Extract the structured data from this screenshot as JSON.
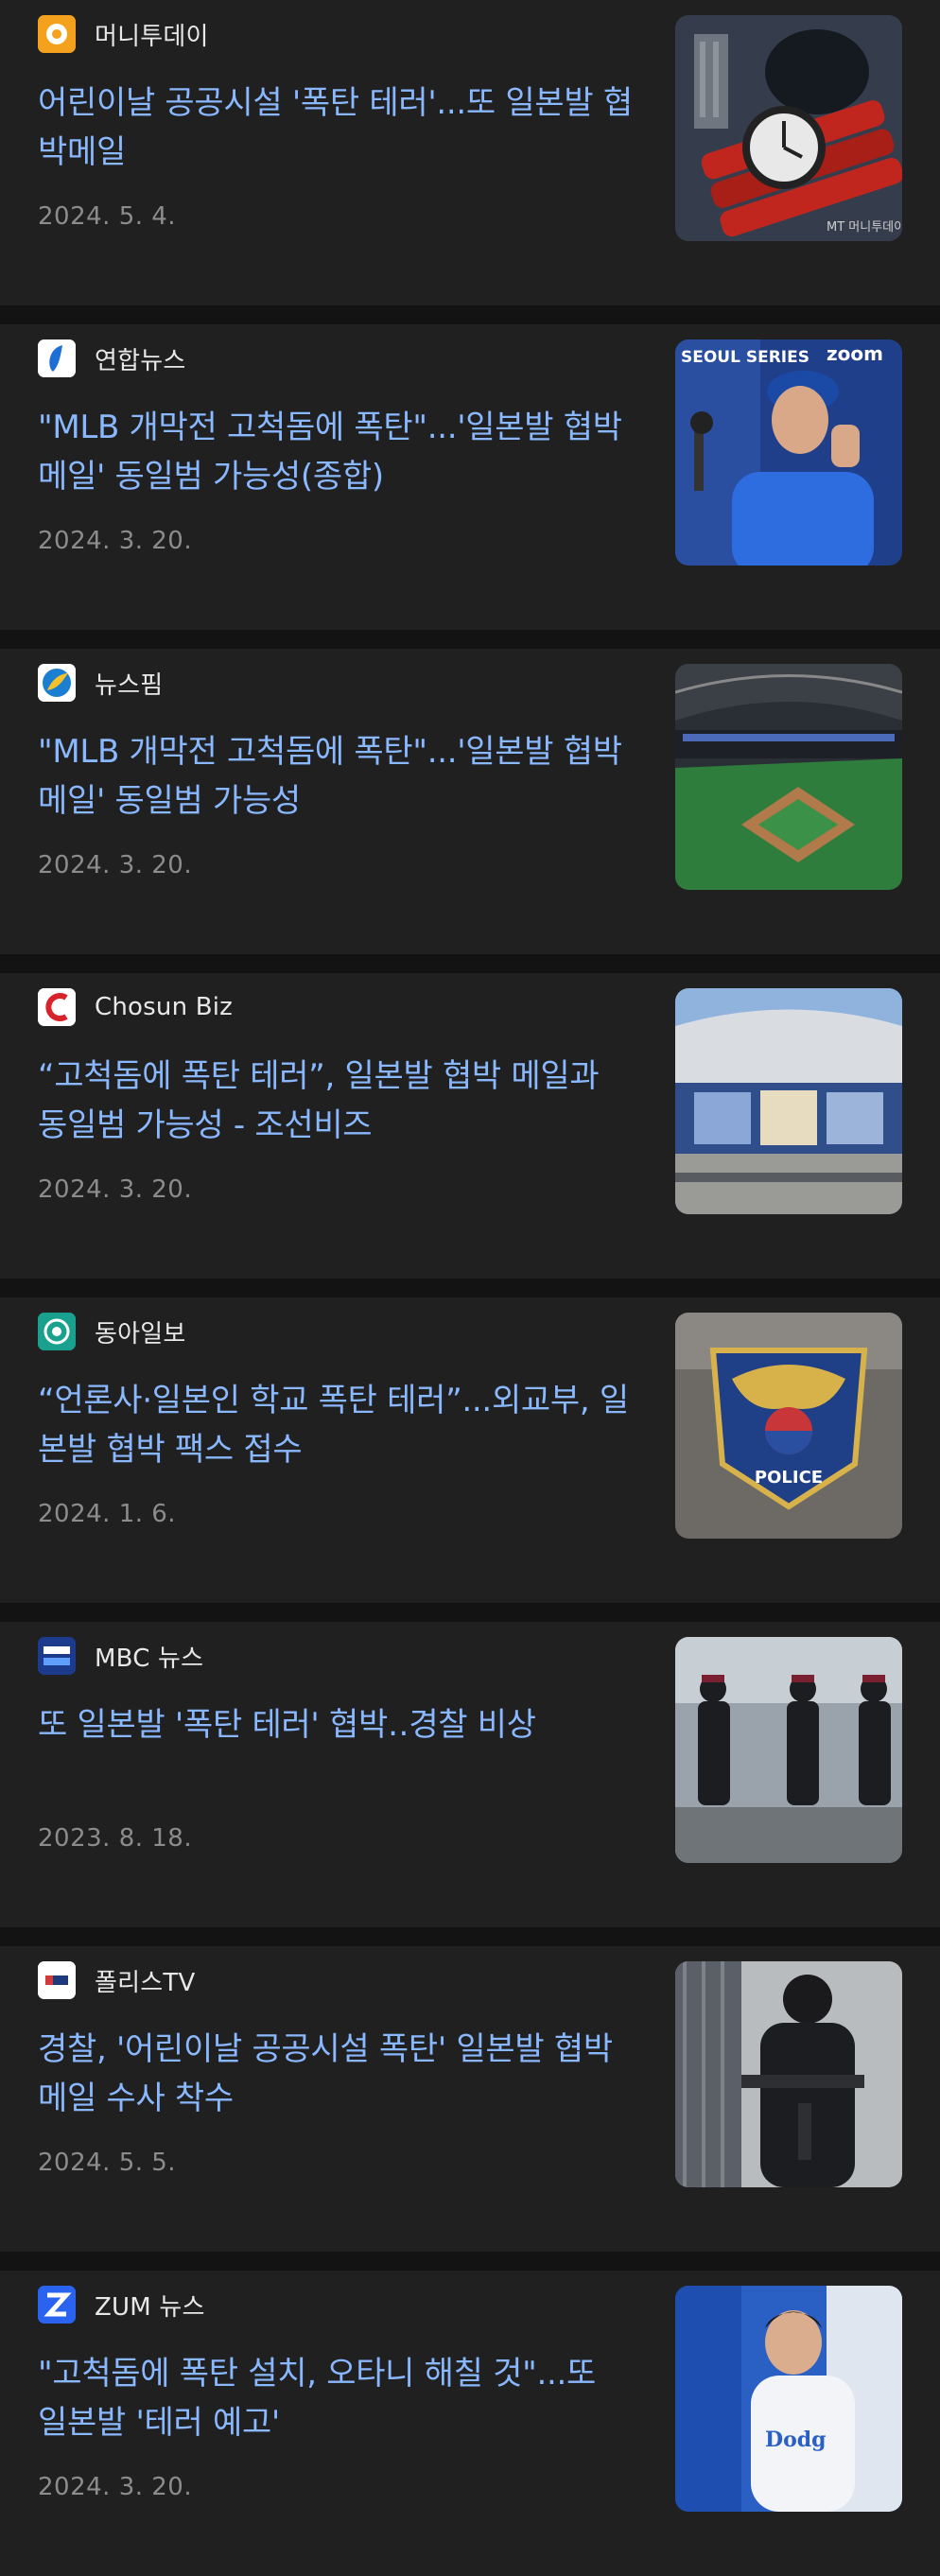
{
  "articles": [
    {
      "source": "머니투데이",
      "logo_icon": "moneytoday-logo-icon",
      "headline": "어린이날 공공시설 '폭탄 테러'...또 일본발 협박메일",
      "date": "2024. 5. 4.",
      "thumb_label": "MT 머니투데이"
    },
    {
      "source": "연합뉴스",
      "logo_icon": "yonhap-logo-icon",
      "headline": "\"MLB 개막전 고척돔에 폭탄\"...'일본발 협박메일' 동일범 가능성(종합)",
      "date": "2024. 3. 20.",
      "thumb_label": "SEOUL SERIES"
    },
    {
      "source": "뉴스핌",
      "logo_icon": "newspim-logo-icon",
      "headline": "\"MLB 개막전 고척돔에 폭탄\"...'일본발 협박메일' 동일범 가능성",
      "date": "2024. 3. 20."
    },
    {
      "source": "Chosun Biz",
      "logo_icon": "chosunbiz-logo-icon",
      "headline": "“고척돔에 폭탄 테러”, 일본발 협박 메일과 동일범 가능성 - 조선비즈",
      "date": "2024. 3. 20."
    },
    {
      "source": "동아일보",
      "logo_icon": "donga-logo-icon",
      "headline": "“언론사·일본인 학교 폭탄 테러”...외교부, 일본발 협박 팩스 접수",
      "date": "2024. 1. 6.",
      "thumb_label": "POLICE"
    },
    {
      "source": "MBC 뉴스",
      "logo_icon": "mbc-logo-icon",
      "headline": "또 일본발 '폭탄 테러' 협박‥경찰 비상",
      "date": "2023. 8. 18."
    },
    {
      "source": "폴리스TV",
      "logo_icon": "policetv-logo-icon",
      "headline": "경찰, '어린이날 공공시설 폭탄' 일본발 협박 메일 수사 착수",
      "date": "2024. 5. 5."
    },
    {
      "source": "ZUM 뉴스",
      "logo_icon": "zum-logo-icon",
      "headline": "\"고척돔에 폭탄 설치, 오타니 해칠 것\"...또 일본발 '테러 예고'",
      "date": "2024. 3. 20."
    }
  ],
  "colors": {
    "background": "#131313",
    "card": "#202020",
    "headline": "#8ab8ff",
    "source": "#e8e8e8",
    "date": "#8c8c8c"
  }
}
